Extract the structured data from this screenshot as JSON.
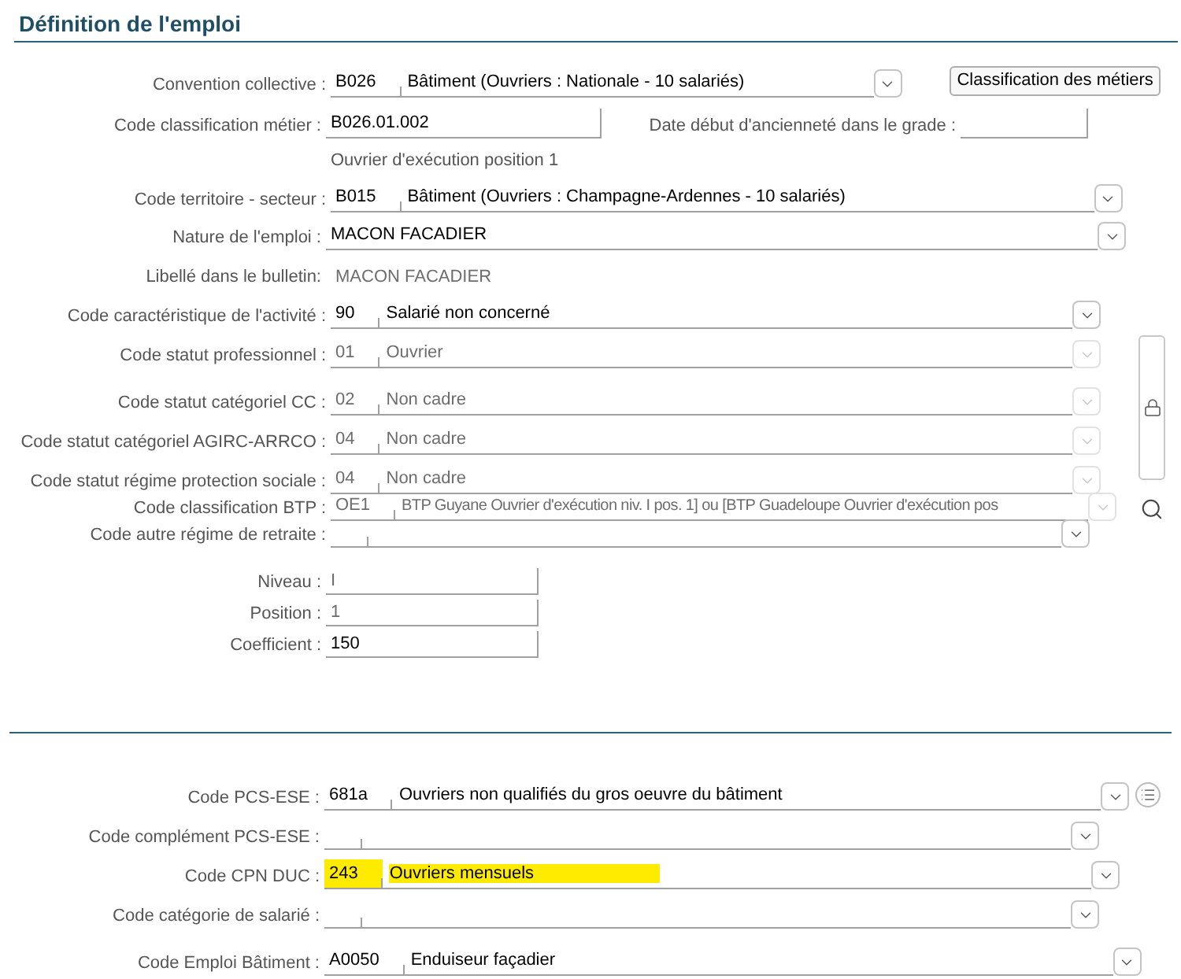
{
  "section_title": "Définition de l'emploi",
  "rows": [
    {
      "kind": "combo",
      "label": "Convention collective :",
      "code": "B026",
      "value": "Bâtiment (Ouvriers : Nationale - 10 salariés)",
      "disabled": false,
      "button": "Classification des métiers"
    },
    {
      "kind": "field",
      "label": "Code classification métier :",
      "value": "B026.01.002",
      "extra_label": "Date début d'ancienneté dans le grade :"
    },
    {
      "kind": "note",
      "value": "Ouvrier d'exécution position 1"
    },
    {
      "kind": "combo",
      "label": "Code territoire - secteur :",
      "code": "B015",
      "value": "Bâtiment (Ouvriers : Champagne-Ardennes - 10 salariés)",
      "disabled": false
    },
    {
      "kind": "select",
      "label": "Nature de l'emploi :",
      "value": "MACON FACADIER",
      "disabled": false
    },
    {
      "kind": "static",
      "label": "Libellé dans le bulletin:",
      "value": "MACON FACADIER"
    },
    {
      "kind": "combo",
      "label": "Code caractéristique de l'activité :",
      "code": "90",
      "value": "Salarié non concerné",
      "disabled": false
    },
    {
      "kind": "combo",
      "label": "Code statut professionnel :",
      "code": "01",
      "value": "Ouvrier",
      "disabled": true
    },
    {
      "kind": "combo",
      "label": "Code statut catégoriel CC :",
      "code": "02",
      "value": "Non cadre",
      "disabled": true
    },
    {
      "kind": "combo",
      "label": "Code statut catégoriel AGIRC-ARRCO :",
      "code": "04",
      "value": "Non cadre",
      "disabled": true
    },
    {
      "kind": "combo",
      "label": "Code statut régime protection sociale :",
      "code": "04",
      "value": "Non cadre",
      "disabled": true
    },
    {
      "kind": "combo",
      "label": "Code classification BTP :",
      "code": "OE1",
      "value": "BTP Guyane Ouvrier d'exécution niv. I pos. 1] ou [BTP Guadeloupe Ouvrier d'exécution pos",
      "disabled": true
    },
    {
      "kind": "combo",
      "label": "Code autre régime de retraite :",
      "disabled": false
    },
    {
      "kind": "short",
      "label": "Niveau :",
      "value": "I",
      "disabled": true
    },
    {
      "kind": "short",
      "label": "Position :",
      "value": "1",
      "disabled": true
    },
    {
      "kind": "short",
      "label": "Coefficient :",
      "value": "150",
      "disabled": false
    }
  ],
  "bottom_rows": [
    {
      "label": "Code PCS-ESE :",
      "code": "681a",
      "value": "Ouvriers non qualifiés du gros oeuvre du bâtiment",
      "highlighted": false
    },
    {
      "label": "Code complément PCS-ESE :",
      "highlighted": false
    },
    {
      "label": "Code CPN DUC :",
      "code": "243",
      "value": "Ouvriers mensuels",
      "highlighted": true
    },
    {
      "label": "Code catégorie de salarié :",
      "highlighted": false
    },
    {
      "label": "Code Emploi Bâtiment :",
      "code": "A0050",
      "value": "Enduiseur façadier",
      "highlighted": false
    }
  ]
}
